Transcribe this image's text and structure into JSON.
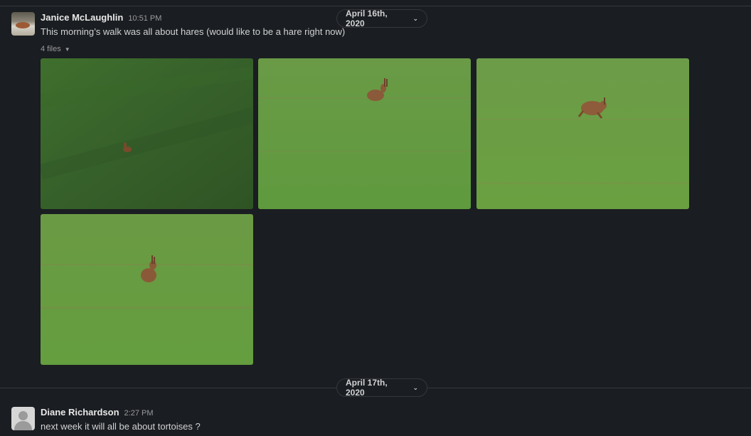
{
  "messages": [
    {
      "sender": "Janice McLaughlin",
      "time": "10:51 PM",
      "text": "This morning’s walk was all about hares (would like to be a hare right now)",
      "files_label": "4 files",
      "attachments": [
        {
          "name": "hare-photo-1",
          "subject": "distant-hare"
        },
        {
          "name": "hare-photo-2",
          "subject": "sitting-hare"
        },
        {
          "name": "hare-photo-3",
          "subject": "running-hare"
        },
        {
          "name": "hare-photo-4",
          "subject": "upright-hare"
        }
      ]
    },
    {
      "sender": "Diane Richardson",
      "time": "2:27 PM",
      "text": "next week it will all be about tortoises ?"
    }
  ],
  "date_dividers": [
    {
      "label": "April 16th, 2020"
    },
    {
      "label": "April 17th, 2020"
    }
  ],
  "colors": {
    "background": "#1a1d21",
    "divider": "#35373b",
    "grass_dark": "#3f6b2c",
    "grass_light": "#6aa245",
    "hare": "#8a5634"
  }
}
